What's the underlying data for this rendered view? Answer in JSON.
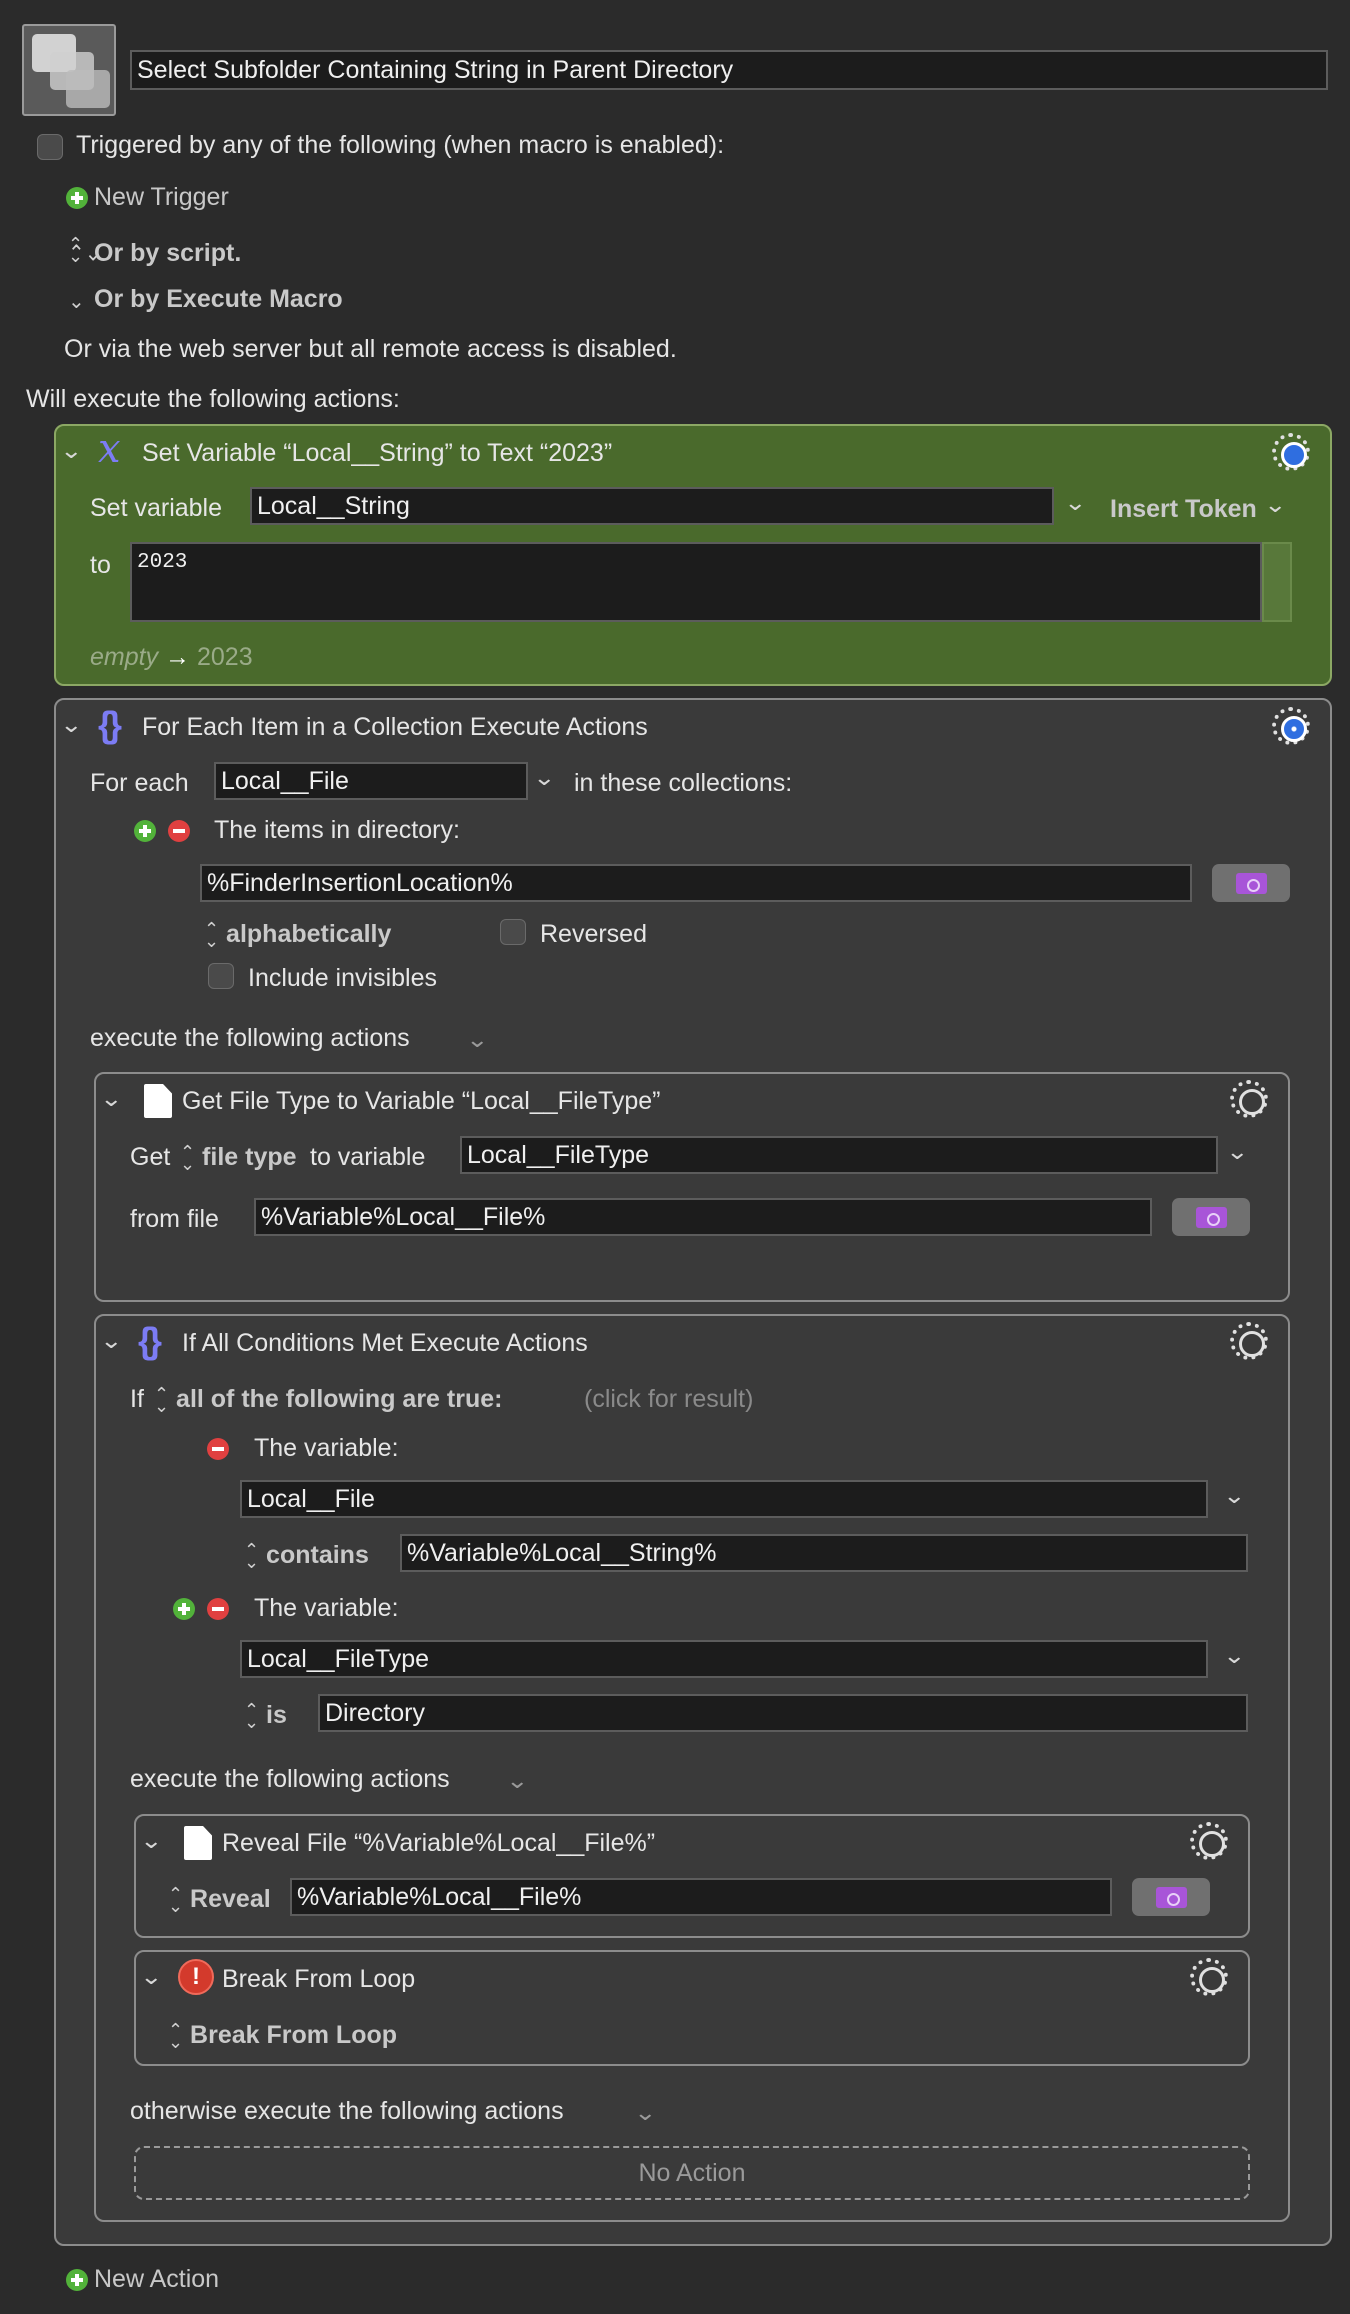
{
  "macro": {
    "name": "Select Subfolder Containing String in Parent Directory",
    "triggered_label": "Triggered by any of the following (when macro is enabled):",
    "new_trigger": "New Trigger",
    "or_by_script": "Or by script.",
    "or_by_execute_macro": "Or by Execute Macro",
    "web_server_note": "Or via the web server but all remote access is disabled.",
    "will_execute": "Will execute the following actions:",
    "new_action": "New Action"
  },
  "set_variable": {
    "title": "Set Variable “Local__String” to Text “2023”",
    "set_label": "Set variable",
    "variable": "Local__String",
    "insert_token": "Insert Token",
    "to_label": "to",
    "text": "2023",
    "preview_empty": "empty",
    "preview_arrow": "→",
    "preview_value": "2023"
  },
  "for_each": {
    "title": "For Each Item in a Collection Execute Actions",
    "for_each_label": "For each",
    "variable": "Local__File",
    "in_collections": "in these collections:",
    "items_in_directory": "The items in directory:",
    "directory": "%FinderInsertionLocation%",
    "sort": "alphabetically",
    "reversed": "Reversed",
    "include_invisibles": "Include invisibles",
    "execute_label": "execute the following actions"
  },
  "get_file_type": {
    "title": "Get File Type to Variable “Local__FileType”",
    "get_label": "Get",
    "type_option": "file type",
    "to_variable": "to variable",
    "variable": "Local__FileType",
    "from_file_label": "from file",
    "file": "%Variable%Local__File%"
  },
  "if_block": {
    "title": "If All Conditions Met Execute Actions",
    "if_label": "If",
    "condition_mode": "all of the following are true:",
    "click_for_result": "(click for result)",
    "cond1_label": "The variable:",
    "cond1_variable": "Local__File",
    "cond1_op": "contains",
    "cond1_value": "%Variable%Local__String%",
    "cond2_label": "The variable:",
    "cond2_variable": "Local__FileType",
    "cond2_op": "is",
    "cond2_value": "Directory",
    "execute_label": "execute the following actions",
    "otherwise_label": "otherwise execute the following actions",
    "no_action": "No Action"
  },
  "reveal_file": {
    "title": "Reveal File “%Variable%Local__File%”",
    "reveal_label": "Reveal",
    "file": "%Variable%Local__File%"
  },
  "break_loop": {
    "title": "Break From Loop",
    "option": "Break From Loop"
  },
  "icons": {
    "trigger_add": "plus-circle-icon",
    "variable": "x-variable-icon",
    "braces": "braces-icon",
    "document": "document-icon",
    "folder": "folder-icon",
    "gear": "gear-icon",
    "warning": "exclamation-icon"
  },
  "colors": {
    "background": "#2b2b2b",
    "set_variable_panel": "#4a6a2c",
    "panel": "#3a3a3a",
    "accent_purple": "#a855d8",
    "braces": "#7c7cf4"
  }
}
